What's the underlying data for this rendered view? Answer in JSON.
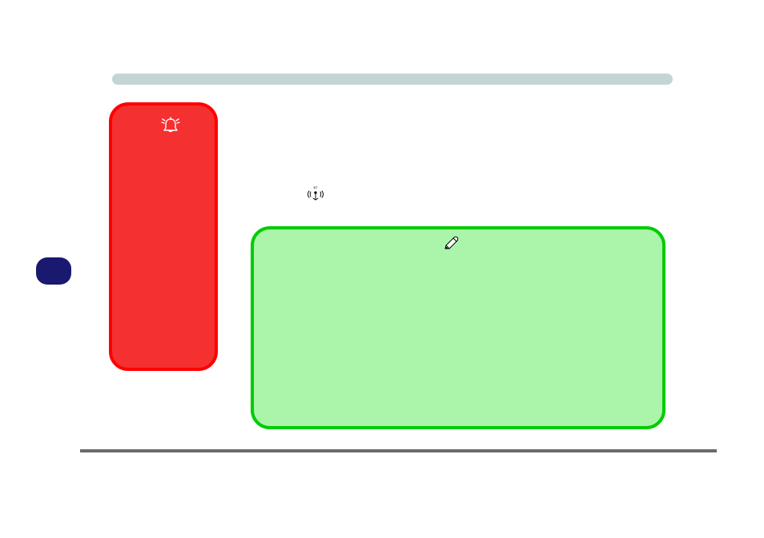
{
  "shapes": {
    "topBar": {
      "color": "#c4d6d4"
    },
    "bluePill": {
      "color": "#191970"
    },
    "redBox": {
      "fill": "#f53030",
      "stroke": "#ff0000"
    },
    "greenBox": {
      "fill": "#aaf5aa",
      "stroke": "#00cc00"
    },
    "bottomLine": {
      "color": "#6b6b6b"
    }
  },
  "icons": {
    "bell": "bell-alarm-icon",
    "bt": "bluetooth-antenna-icon",
    "pen": "pen-icon"
  }
}
